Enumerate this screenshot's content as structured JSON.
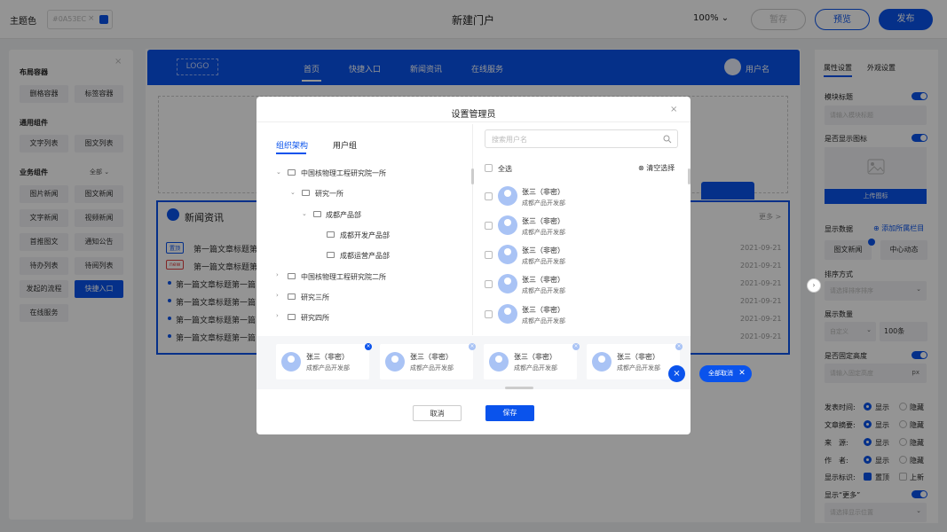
{
  "topbar": {
    "theme_label": "主题色",
    "color_value": "#0A53EC",
    "clear": "×",
    "title": "新建门户",
    "zoom": "100%",
    "zoom_caret": "⌄",
    "save": "暂存",
    "preview": "预览",
    "publish": "发布"
  },
  "colors": {
    "accent": "#0A53EC"
  },
  "left": {
    "close": "×",
    "sec_layout": "布局容器",
    "layout_items": [
      "删格容器",
      "标签容器"
    ],
    "sec_common": "通用组件",
    "common_items": [
      "文字列表",
      "图文列表"
    ],
    "sec_biz": "业务组件",
    "biz_all": "全部 ⌄",
    "biz_items": [
      "图片新闻",
      "图文新闻",
      "文字新闻",
      "视频新闻",
      "首推图文",
      "通知公告",
      "待办列表",
      "待阅列表",
      "发起的流程",
      "快捷入口",
      "在线服务"
    ]
  },
  "canvas": {
    "logo": "LOGO",
    "nav": [
      "首页",
      "快捷入口",
      "新闻资讯",
      "在线服务"
    ],
    "user": "用户名",
    "news_title": "新闻资讯",
    "news_more": "更多 >",
    "tag_top": "置顶",
    "tag_new": "new",
    "rows": [
      "第一篇文章标题第",
      "第一篇文章标题第",
      "第一篇文章标题第一篇",
      "第一篇文章标题第一篇",
      "第一篇文章标题第一篇",
      "第一篇文章标题第一篇"
    ],
    "dates": [
      "2021-09-21",
      "2021-09-21",
      "2021-09-21",
      "2021-09-21",
      "2021-09-21",
      "2021-09-21"
    ]
  },
  "right": {
    "tab_props": "属性设置",
    "tab_look": "外观设置",
    "module_title": "模块标题",
    "module_title_ph": "请输入模块标题",
    "show_icon": "是否显示图标",
    "upload": "上传图标",
    "show_data": "显示数据",
    "add_column": "添加所属栏目",
    "chips": [
      "图文新闻",
      "中心动态"
    ],
    "sort": "排序方式",
    "sort_ph": "请选择排序排序",
    "count": "展示数量",
    "count_custom": "自定义",
    "count_value": "100条",
    "fixed_height": "是否固定高度",
    "height_ph": "请输入固定高度",
    "px": "px",
    "opts": [
      {
        "label": "发表时间:",
        "a": "显示",
        "b": "隐藏"
      },
      {
        "label": "文章摘要:",
        "a": "显示",
        "b": "隐藏"
      },
      {
        "label": "来　源:",
        "a": "显示",
        "b": "隐藏"
      },
      {
        "label": "作　者:",
        "a": "显示",
        "b": "隐藏"
      },
      {
        "label": "显示标识:",
        "a": "置顶",
        "b": "上新"
      }
    ],
    "show_more": "显示“更多”",
    "show_more_ph": "请选择显示位置"
  },
  "modal": {
    "title": "设置管理员",
    "close": "×",
    "tab_org": "组织架构",
    "tab_group": "用户组",
    "tree": [
      "中国核物理工程研究院一所",
      "研究一所",
      "成都产品部",
      "成都开发产品部",
      "成都运营产品部",
      "中国核物理工程研究院二所",
      "研究三所",
      "研究四所"
    ],
    "search_ph": "搜索用户名",
    "select_all": "全选",
    "clear": "清空选择",
    "users": [
      {
        "name": "张三（非密）",
        "dept": "成都产品开发部"
      },
      {
        "name": "张三（非密）",
        "dept": "成都产品开发部"
      },
      {
        "name": "张三（非密）",
        "dept": "成都产品开发部"
      },
      {
        "name": "张三（非密）",
        "dept": "成都产品开发部"
      },
      {
        "name": "张三（非密）",
        "dept": "成都产品开发部"
      }
    ],
    "selected": [
      {
        "name": "张三（非密）",
        "dept": "成都产品开发部"
      },
      {
        "name": "张三（非密）",
        "dept": "成都产品开发部"
      },
      {
        "name": "张三（非密）",
        "dept": "成都产品开发部"
      },
      {
        "name": "张三（非密）",
        "dept": "成都产品开发部"
      }
    ],
    "cancel": "取消",
    "ok": "保存",
    "cancel_all": "全部取消",
    "fab": "×",
    "side_arrow": "›"
  }
}
